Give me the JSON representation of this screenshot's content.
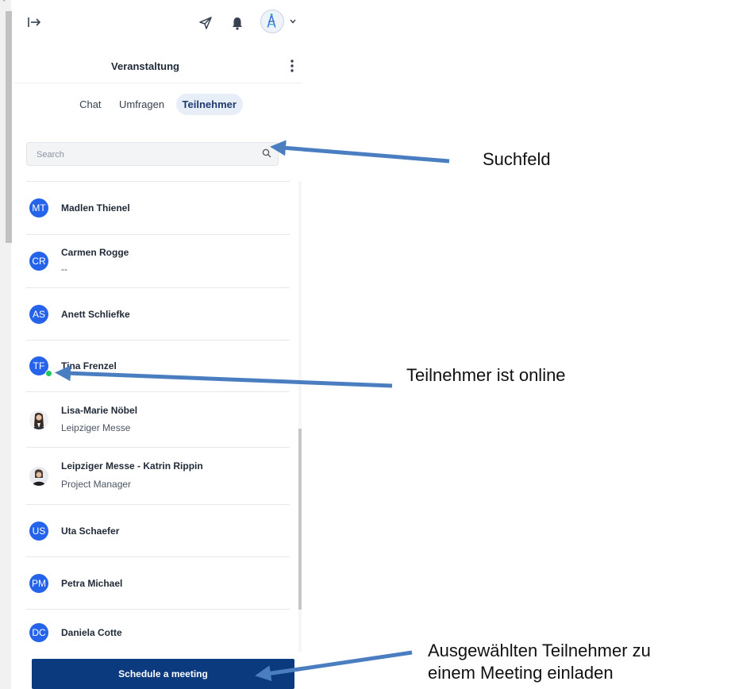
{
  "header": {
    "event_title": "Veranstaltung"
  },
  "tabs": [
    {
      "label": "Chat",
      "active": false
    },
    {
      "label": "Umfragen",
      "active": false
    },
    {
      "label": "Teilnehmer",
      "active": true
    }
  ],
  "search": {
    "placeholder": "Search",
    "value": ""
  },
  "participants": [
    {
      "initials": "MT",
      "name": "Madlen Thienel",
      "subtitle": "",
      "online": false,
      "photo": false
    },
    {
      "initials": "CR",
      "name": "Carmen Rogge",
      "subtitle": "--",
      "online": false,
      "photo": false
    },
    {
      "initials": "AS",
      "name": "Anett Schliefke",
      "subtitle": "",
      "online": false,
      "photo": false
    },
    {
      "initials": "TF",
      "name": "Tina Frenzel",
      "subtitle": "",
      "online": true,
      "photo": false
    },
    {
      "initials": "",
      "name": "Lisa-Marie Nöbel",
      "subtitle": "Leipziger Messe",
      "online": false,
      "photo": true
    },
    {
      "initials": "",
      "name": "Leipziger Messe - Katrin Rippin",
      "subtitle": "Project Manager",
      "online": false,
      "photo": true
    },
    {
      "initials": "US",
      "name": "Uta Schaefer",
      "subtitle": "",
      "online": false,
      "photo": false
    },
    {
      "initials": "PM",
      "name": "Petra Michael",
      "subtitle": "",
      "online": false,
      "photo": false
    },
    {
      "initials": "DC",
      "name": "Daniela Cotte",
      "subtitle": "",
      "online": false,
      "photo": false
    }
  ],
  "actions": {
    "schedule_label": "Schedule a meeting"
  },
  "annotations": {
    "search_label": "Suchfeld",
    "online_label": "Teilnehmer ist online",
    "invite_label_line1": "Ausgewählten Teilnehmer zu",
    "invite_label_line2": "einem Meeting einladen"
  },
  "colors": {
    "avatar_blue": "#2563eb",
    "button_navy": "#0b3a7e",
    "online_green": "#22c55e",
    "arrow_blue": "#4a7ec0"
  },
  "icons": [
    "collapse-panel-icon",
    "send-icon",
    "bell-icon",
    "logo-avatar-icon",
    "chevron-down-icon",
    "kebab-menu-icon",
    "search-icon"
  ]
}
